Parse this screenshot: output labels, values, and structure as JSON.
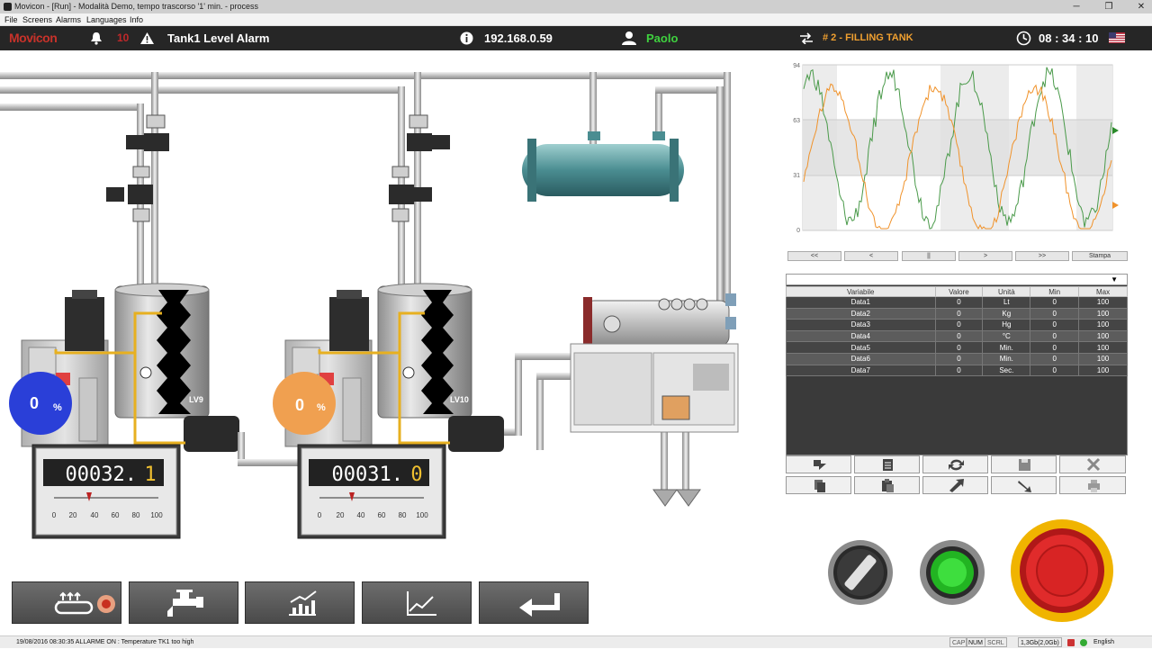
{
  "window": {
    "title": "Movicon - [Run] - Modalità Demo, tempo trascorso '1' min. - process",
    "minimize": "─",
    "maximize": "❐",
    "close": "✕"
  },
  "menu": [
    "File",
    "Screens",
    "Alarms",
    "Languages",
    "Info"
  ],
  "header": {
    "logo": "Movicon",
    "alarm_count": "10",
    "alarm_text": "Tank1 Level Alarm",
    "ip": "192.168.0.59",
    "user": "Paolo",
    "step": "# 2 - FILLING TANK",
    "time": "08 : 34 : 10",
    "accent": "#f0a030",
    "user_color": "#3fd13f"
  },
  "plant": {
    "tank1_label": "LV9",
    "tank2_label": "LV10",
    "gauge1": {
      "value": "0",
      "unit": "%",
      "color": "#2a3fd8"
    },
    "gauge2": {
      "value": "0",
      "unit": "%",
      "color": "#f0a050"
    },
    "meter1": {
      "digits": "00032.",
      "last": "1",
      "scale": [
        "0",
        "20",
        "40",
        "60",
        "80",
        "100"
      ],
      "needle_pct": 32
    },
    "meter2": {
      "digits": "00031.",
      "last": "0",
      "scale": [
        "0",
        "20",
        "40",
        "60",
        "80",
        "100"
      ],
      "needle_pct": 31
    }
  },
  "trend": {
    "y_ticks": [
      "94",
      "63",
      "31",
      "0"
    ],
    "series": [
      {
        "color": "#4a9a4a"
      },
      {
        "color": "#f0922a"
      }
    ],
    "buttons": [
      "<<",
      "<",
      "||",
      ">",
      ">>",
      "Stampa"
    ]
  },
  "grid": {
    "columns": [
      "Variabile",
      "Valore",
      "Unità",
      "Min",
      "Max"
    ],
    "rows": [
      [
        "Data1",
        "0",
        "Lt",
        "0",
        "100"
      ],
      [
        "Data2",
        "0",
        "Kg",
        "0",
        "100"
      ],
      [
        "Data3",
        "0",
        "Hg",
        "0",
        "100"
      ],
      [
        "Data4",
        "0",
        "°C",
        "0",
        "100"
      ],
      [
        "Data5",
        "0",
        "Min.",
        "0",
        "100"
      ],
      [
        "Data6",
        "0",
        "Min.",
        "0",
        "100"
      ],
      [
        "Data7",
        "0",
        "Sec.",
        "0",
        "100"
      ]
    ],
    "dropdown_arrow": "▼"
  },
  "status": {
    "message": "19/08/2016 08:30:35 ALLARME ON : Temperature TK1 too high",
    "cap": "CAP",
    "num": "NUM",
    "scrl": "SCRL",
    "memory": "1,3Gb(2,0Gb)",
    "language": "English"
  }
}
